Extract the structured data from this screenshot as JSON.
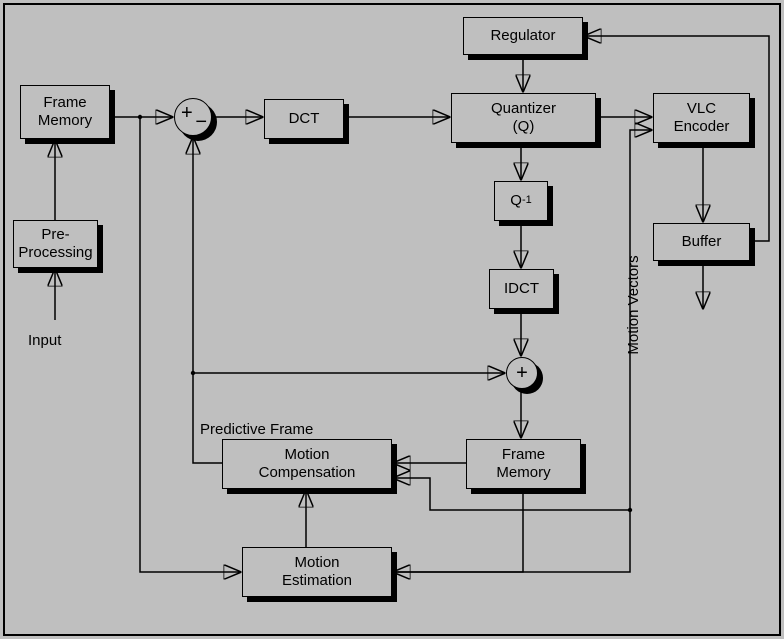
{
  "blocks": {
    "frame_memory1": "Frame\nMemory",
    "pre_processing": "Pre-\nProcessing",
    "dct": "DCT",
    "regulator": "Regulator",
    "quantizer": "Quantizer\n(Q)",
    "vlc_encoder": "VLC\nEncoder",
    "buffer": "Buffer",
    "qinv": "Q",
    "qinv_sup": "-1",
    "idct": "IDCT",
    "frame_memory2": "Frame\nMemory",
    "motion_compensation": "Motion\nCompensation",
    "motion_estimation": "Motion\nEstimation"
  },
  "labels": {
    "input": "Input",
    "predictive_frame": "Predictive Frame",
    "motion_vectors": "Motion Vectors"
  },
  "ops": {
    "sum_plus": "+",
    "sum_minus": "−",
    "adder_plus": "+"
  }
}
